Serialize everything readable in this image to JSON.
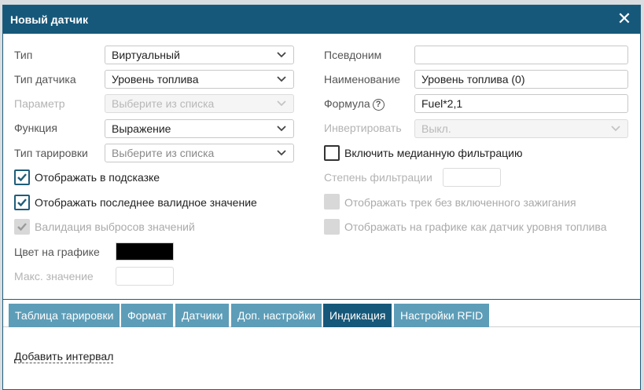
{
  "dialog": {
    "title": "Новый датчик",
    "close_glyph": "✕"
  },
  "left": {
    "type_label": "Тип",
    "type_value": "Виртуальный",
    "sensor_type_label": "Тип датчика",
    "sensor_type_value": "Уровень топлива",
    "param_label": "Параметр",
    "param_placeholder": "Выберите из списка",
    "function_label": "Функция",
    "function_value": "Выражение",
    "calib_label": "Тип тарировки",
    "calib_placeholder": "Выберите из списка",
    "show_tooltip_label": "Отображать в подсказке",
    "show_last_valid_label": "Отображать последнее валидное значение",
    "outlier_validation_label": "Валидация выбросов значений",
    "graph_color_label": "Цвет на графике",
    "graph_color": "#000000",
    "max_value_label": "Макс. значение"
  },
  "right": {
    "alias_label": "Псевдоним",
    "alias_value": "",
    "name_label": "Наименование",
    "name_value": "Уровень топлива (0)",
    "formula_label": "Формула",
    "formula_help": "?",
    "formula_value": "Fuel*2,1",
    "invert_label": "Инвертировать",
    "invert_value": "Выкл.",
    "median_label": "Включить медианную фильтрацию",
    "filter_degree_label": "Степень фильтрации",
    "track_no_ignition_label": "Отображать трек без включенного зажигания",
    "show_as_fuel_label": "Отображать на графике как датчик уровня топлива"
  },
  "tabs": [
    {
      "label": "Таблица тарировки"
    },
    {
      "label": "Формат"
    },
    {
      "label": "Датчики"
    },
    {
      "label": "Доп. настройки"
    },
    {
      "label": "Индикация",
      "active": true
    },
    {
      "label": "Настройки RFID"
    }
  ],
  "indication": {
    "add_interval_label": "Добавить интервал"
  },
  "icons": {
    "close": "close-icon",
    "chevron": "chevron-down-icon",
    "check": "check-icon",
    "help": "help-icon"
  },
  "colors": {
    "header": "#16587a",
    "tab": "#5d9db8",
    "tab_active": "#16587a"
  }
}
